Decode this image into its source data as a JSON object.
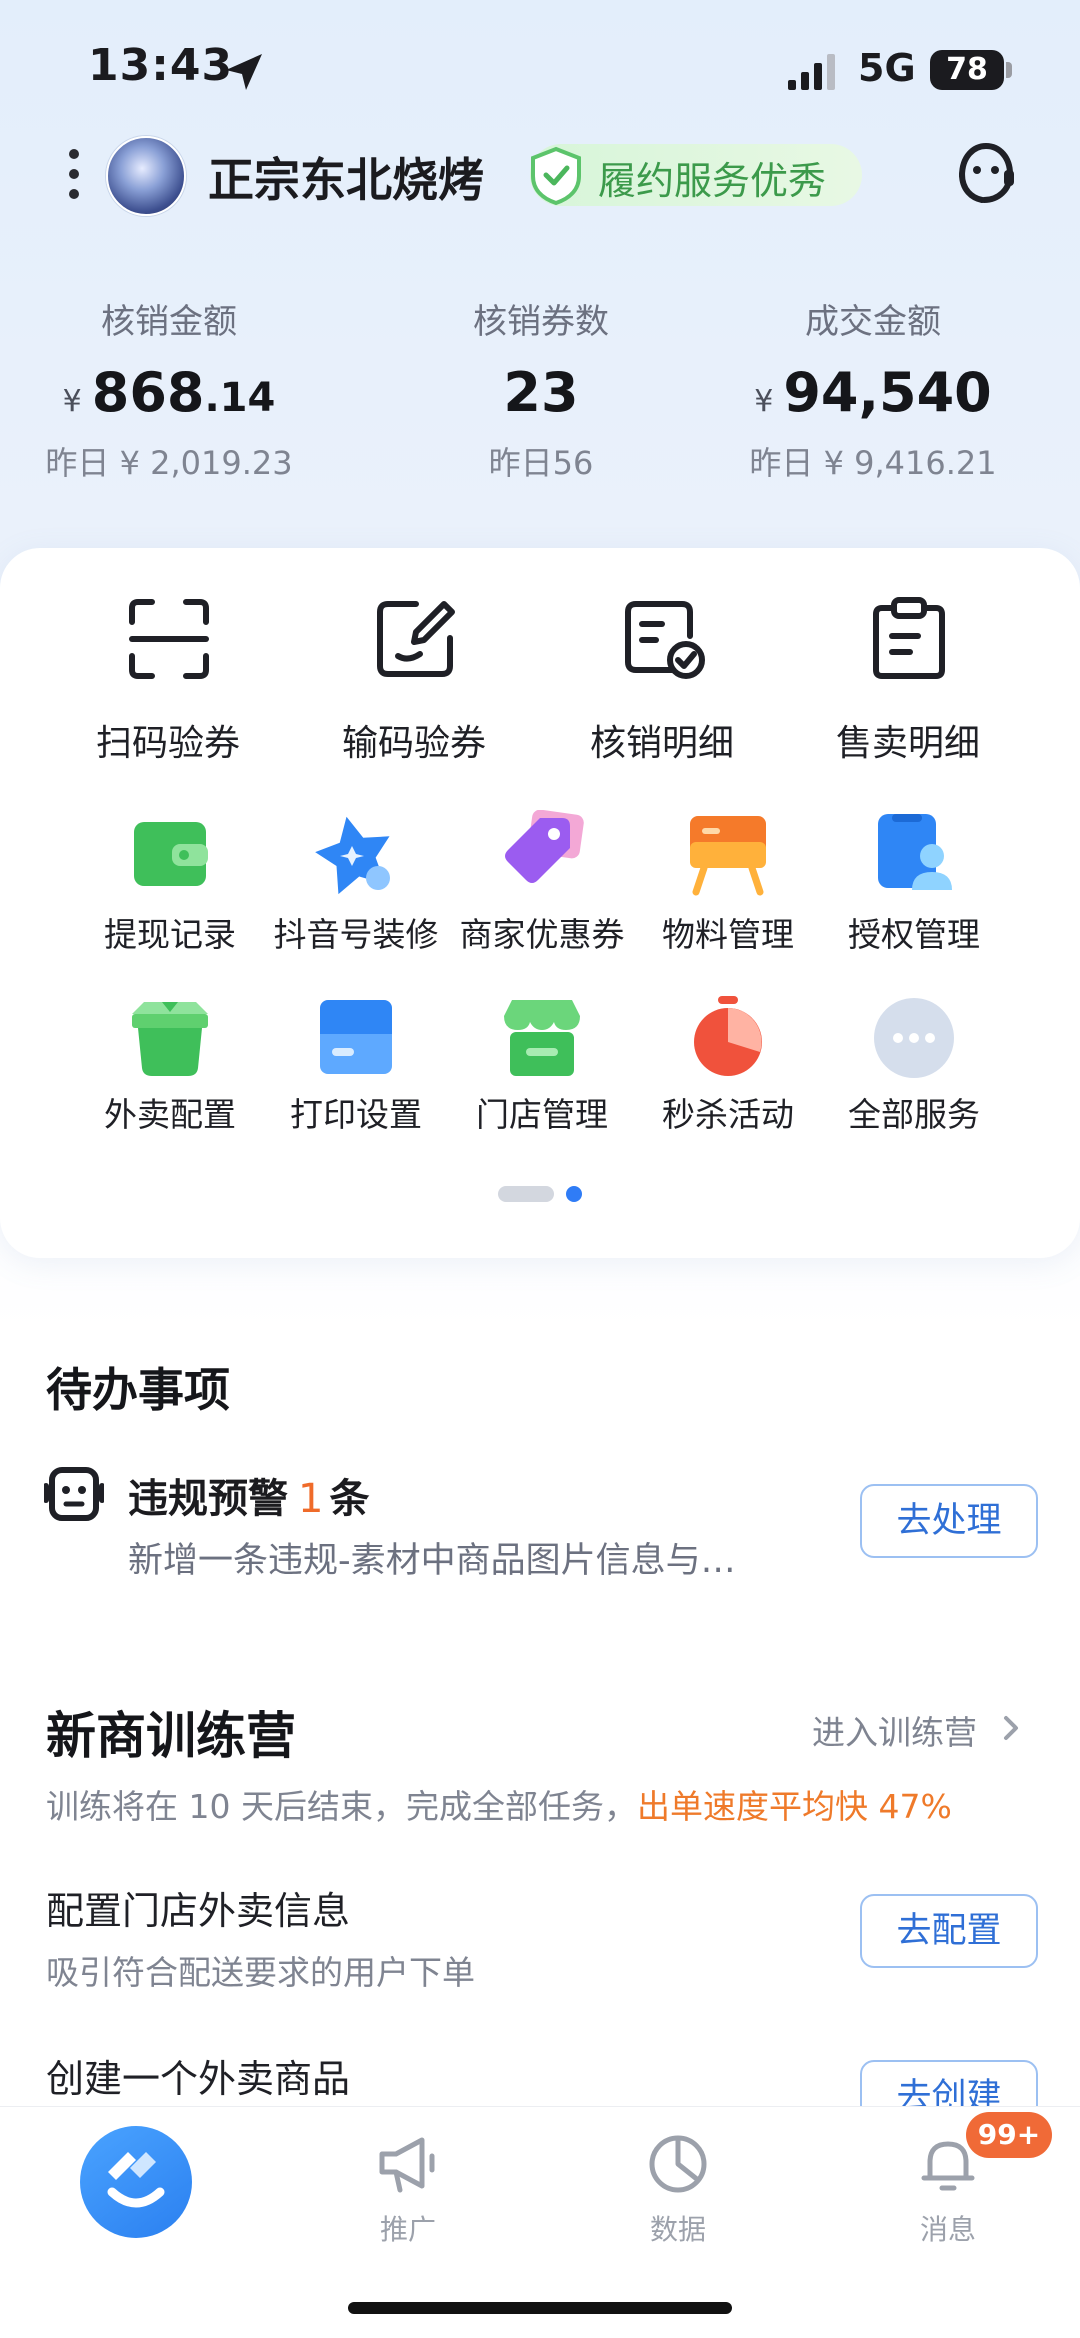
{
  "status_bar": {
    "time": "13:43",
    "network": "5G",
    "battery": "78"
  },
  "header": {
    "store_name": "正宗东北烧烤",
    "badge": "履约服务优秀"
  },
  "stats": [
    {
      "label": "核销金额",
      "currency": "¥",
      "value_int": "868",
      "value_dec": ".14",
      "sub": "昨日 ¥ 2,019.23"
    },
    {
      "label": "核销券数",
      "value_int": "23",
      "sub": "昨日56"
    },
    {
      "label": "成交金额",
      "currency": "¥",
      "value_int": "94,540",
      "sub": "昨日 ¥ 9,416.21"
    }
  ],
  "quick_actions": [
    {
      "label": "扫码验券",
      "icon": "scan-icon"
    },
    {
      "label": "输码验券",
      "icon": "edit-code-icon"
    },
    {
      "label": "核销明细",
      "icon": "verify-detail-icon"
    },
    {
      "label": "售卖明细",
      "icon": "clipboard-icon"
    }
  ],
  "services_row1": [
    {
      "label": "提现记录",
      "icon": "wallet-icon",
      "color": "#3fbf5a"
    },
    {
      "label": "抖音号装修",
      "icon": "star-icon",
      "color": "#2f86f5"
    },
    {
      "label": "商家优惠券",
      "icon": "coupon-tag-icon",
      "color": "#9b5cf0"
    },
    {
      "label": "物料管理",
      "icon": "easel-icon",
      "color": "#f57a2a"
    },
    {
      "label": "授权管理",
      "icon": "authorize-icon",
      "color": "#2f86f5"
    }
  ],
  "services_row2": [
    {
      "label": "外卖配置",
      "icon": "delivery-bag-icon",
      "color": "#3fbf5a"
    },
    {
      "label": "打印设置",
      "icon": "printer-icon",
      "color": "#2f86f5"
    },
    {
      "label": "门店管理",
      "icon": "storefront-icon",
      "color": "#3fbf5a"
    },
    {
      "label": "秒杀活动",
      "icon": "stopwatch-icon",
      "color": "#f0523c"
    },
    {
      "label": "全部服务",
      "icon": "more-icon",
      "color": "#c9d4e6"
    }
  ],
  "todo": {
    "title": "待办事项",
    "item_title": "违规预警",
    "item_count": "1",
    "item_unit": "条",
    "item_desc": "新增一条违规-素材中商品图片信息与…",
    "action": "去处理"
  },
  "training": {
    "title": "新商训练营",
    "enter_link": "进入训练营",
    "desc_prefix": "训练将在 10 天后结束，完成全部任务，",
    "desc_highlight": "出单速度平均快 47%",
    "tasks": [
      {
        "title": "配置门店外卖信息",
        "sub": "吸引符合配送要求的用户下单",
        "action": "去配置"
      },
      {
        "title": "创建一个外卖商品",
        "action": "去创建"
      }
    ]
  },
  "tabbar": {
    "items": [
      {
        "label": "推广",
        "icon": "megaphone-icon"
      },
      {
        "label": "数据",
        "icon": "pie-chart-icon"
      },
      {
        "label": "消息",
        "icon": "bell-icon"
      }
    ],
    "message_badge": "99+"
  },
  "colors": {
    "accent": "#2f7cf6",
    "highlight": "#ef7a2a",
    "badge_green": "#3c9a4b"
  }
}
